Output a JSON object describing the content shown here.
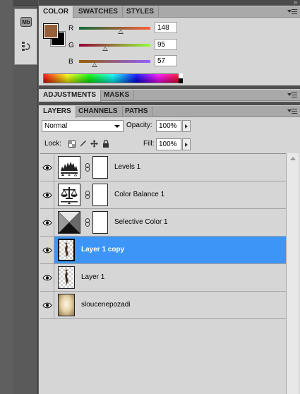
{
  "color_panel": {
    "tabs": [
      "COLOR",
      "SWATCHES",
      "STYLES"
    ],
    "foreground_color": "#945f39",
    "background_color": "#000000",
    "sliders": [
      {
        "label": "R",
        "value": "148",
        "fraction": 0.58,
        "track_from": "#0f6b3a",
        "track_to": "#ff5f3a"
      },
      {
        "label": "G",
        "value": "95",
        "fraction": 0.37,
        "track_from": "#94003a",
        "track_to": "#94ff3a"
      },
      {
        "label": "B",
        "value": "57",
        "fraction": 0.22,
        "track_from": "#945f00",
        "track_to": "#945fff"
      }
    ]
  },
  "adjustments_panel": {
    "tabs": [
      "ADJUSTMENTS",
      "MASKS"
    ]
  },
  "layers_panel": {
    "tabs": [
      "LAYERS",
      "CHANNELS",
      "PATHS"
    ],
    "blend_mode": "Normal",
    "opacity_label": "Opacity:",
    "opacity_value": "100%",
    "lock_label": "Lock:",
    "fill_label": "Fill:",
    "fill_value": "100%",
    "layers": [
      {
        "name": "Levels 1",
        "kind": "levels-adjustment",
        "selected": false
      },
      {
        "name": "Color Balance 1",
        "kind": "color-balance-adjustment",
        "selected": false
      },
      {
        "name": "Selective Color 1",
        "kind": "selective-color-adjustment",
        "selected": false
      },
      {
        "name": "Layer 1 copy",
        "kind": "pixel-layer",
        "selected": true
      },
      {
        "name": "Layer 1",
        "kind": "pixel-layer",
        "selected": false
      },
      {
        "name": "sloucenepozadi",
        "kind": "pixel-layer",
        "selected": false
      }
    ]
  },
  "left_dock": {
    "buttons": [
      "mini-bridge-icon",
      "history-icon"
    ],
    "mini_bridge_text": "Mb"
  }
}
